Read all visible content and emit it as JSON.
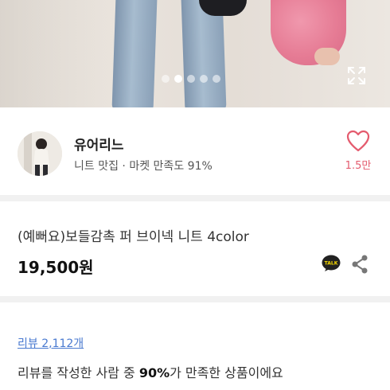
{
  "gallery": {
    "dot_count": 5,
    "active_index": 1
  },
  "seller": {
    "name": "유어리느",
    "category": "니트 맛집",
    "separator": " · ",
    "satisfaction_label": "마켓 만족도",
    "satisfaction_value": "91%"
  },
  "like": {
    "count": "1.5만"
  },
  "product": {
    "title": "(예뻐요)보들감촉 퍼 브이넥 니트 4color",
    "price": "19,500원"
  },
  "review": {
    "link_label": "리뷰 2,112개",
    "summary_prefix": "리뷰를 작성한 사람 중 ",
    "summary_highlight": "90%",
    "summary_suffix": "가 만족한 상품이에요"
  },
  "colors": {
    "accent_pink": "#e45b6e",
    "link_blue": "#4a7ad0",
    "kakao_yellow": "#f7d900"
  },
  "icons": [
    "expand-icon",
    "heart-icon",
    "kakaotalk-icon",
    "share-icon"
  ]
}
